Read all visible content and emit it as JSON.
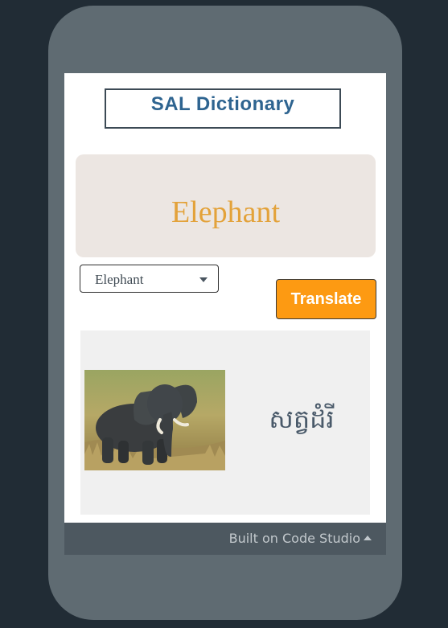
{
  "app": {
    "title": "SAL Dictionary"
  },
  "word_display": {
    "text": "Elephant"
  },
  "dropdown": {
    "selected": "Elephant"
  },
  "translate_button": {
    "label": "Translate"
  },
  "result": {
    "image_subject": "elephant photo",
    "translation": "សត្វដំរី"
  },
  "footer": {
    "link_label": "Built on Code Studio"
  },
  "colors": {
    "background": "#212c35",
    "device": "#5f6b72",
    "title_text": "#2e6490",
    "word_text": "#e3a23a",
    "word_panel": "#ece6e2",
    "button": "#fd9a12",
    "result_panel": "#f0f0f0",
    "footer_bar": "#4d5860"
  },
  "icons": {
    "dropdown": "caret-down-icon",
    "footer": "caret-up-icon"
  }
}
